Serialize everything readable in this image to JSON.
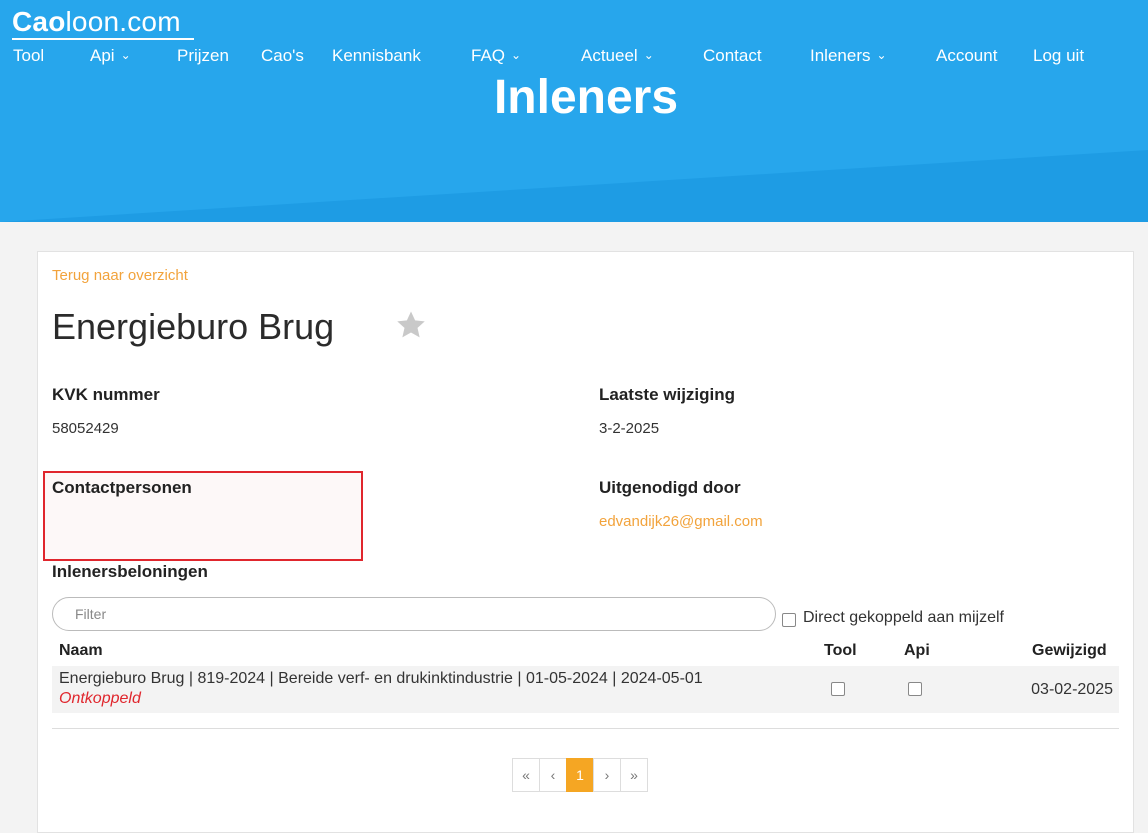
{
  "brand": {
    "logo_bold": "Cao",
    "logo_rest": "loon",
    "logo_tld": ".com"
  },
  "nav": [
    {
      "label": "Tool",
      "dropdown": false
    },
    {
      "label": "Api",
      "dropdown": true
    },
    {
      "label": "Prijzen",
      "dropdown": false
    },
    {
      "label": "Cao's",
      "dropdown": false
    },
    {
      "label": "Kennisbank",
      "dropdown": false
    },
    {
      "label": "FAQ",
      "dropdown": true
    },
    {
      "label": "Actueel",
      "dropdown": true
    },
    {
      "label": "Contact",
      "dropdown": false
    },
    {
      "label": "Inleners",
      "dropdown": true
    },
    {
      "label": "Account",
      "dropdown": false
    },
    {
      "label": "Log uit",
      "dropdown": false
    }
  ],
  "hero": {
    "title": "Inleners"
  },
  "detail": {
    "back_link": "Terug naar overzicht",
    "company_name": "Energieburo Brug",
    "kvk_label": "KVK nummer",
    "kvk_value": "58052429",
    "last_change_label": "Laatste wijziging",
    "last_change_value": "3-2-2025",
    "contacts_label": "Contactpersonen",
    "invited_label": "Uitgenodigd door",
    "invited_value": "edvandijk26@gmail.com",
    "rewards_label": "Inlenersbeloningen"
  },
  "filter": {
    "placeholder": "Filter",
    "value": ""
  },
  "direct_checkbox": {
    "label": "Direct gekoppeld aan mijzelf",
    "checked": false
  },
  "table": {
    "headers": {
      "name": "Naam",
      "tool": "Tool",
      "api": "Api",
      "changed": "Gewijzigd"
    },
    "rows": [
      {
        "name": "Energieburo Brug | 819-2024 | Bereide verf- en drukinktindustrie | 01-05-2024 | 2024-05-01",
        "status": "Ontkoppeld",
        "tool": false,
        "api": false,
        "changed": "03-02-2025"
      }
    ]
  },
  "pagination": {
    "first": "«",
    "prev": "‹",
    "current": "1",
    "next": "›",
    "last": "»"
  },
  "colors": {
    "hero": "#24a5ea",
    "accent": "#f5a623",
    "link": "#f2a33c",
    "alert": "#e0262d"
  },
  "icons": {
    "favorite": "star-icon",
    "dropdown": "chevron-down-icon"
  }
}
